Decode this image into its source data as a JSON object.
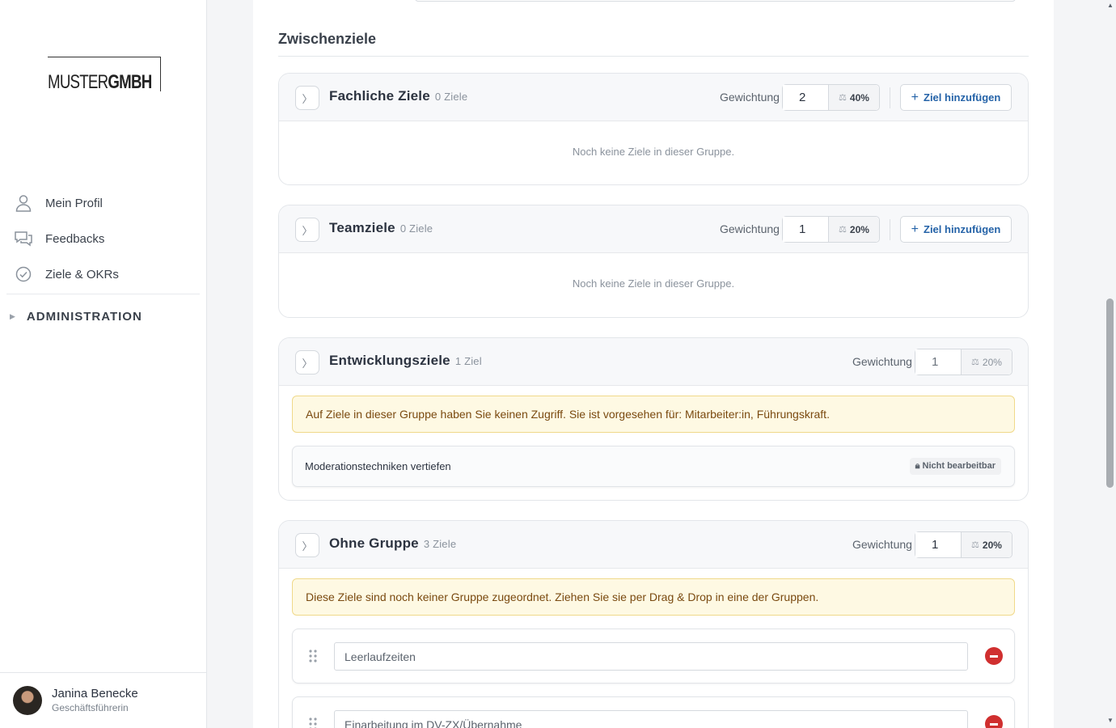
{
  "sidebar": {
    "logo": {
      "part1": "MUSTER",
      "part2": "GMBH"
    },
    "nav": [
      {
        "label": "Mein Profil",
        "icon": "user-icon"
      },
      {
        "label": "Feedbacks",
        "icon": "chat-bubbles-icon"
      },
      {
        "label": "Ziele & OKRs",
        "icon": "check-circle-icon"
      }
    ],
    "admin_label": "ADMINISTRATION",
    "user": {
      "name": "Janina Benecke",
      "role": "Geschäftsführerin"
    }
  },
  "section": {
    "title": "Zwischenziele"
  },
  "common": {
    "weight_label": "Gewichtung",
    "add_label": "Ziel hinzufügen",
    "empty_text": "Noch keine Ziele in dieser Gruppe.",
    "scale_icon": "scale-icon"
  },
  "groups": [
    {
      "name": "Fachliche Ziele",
      "count": "0 Ziele",
      "weight": "2",
      "percent": "40%"
    },
    {
      "name": "Teamziele",
      "count": "0 Ziele",
      "weight": "1",
      "percent": "20%"
    },
    {
      "name": "Entwicklungsziele",
      "count": "1 Ziel",
      "weight": "1",
      "percent": "20%",
      "warning": "Auf Ziele in dieser Gruppe haben Sie keinen Zugriff. Sie ist vorgesehen für: Mitarbeiter:in, Führungskraft.",
      "items": [
        {
          "title": "Moderationstechniken vertiefen",
          "badge": "Nicht bearbeitbar"
        }
      ]
    },
    {
      "name": "Ohne Gruppe",
      "count": "3 Ziele",
      "weight": "1",
      "percent": "20%",
      "warning": "Diese Ziele sind noch keiner Gruppe zugeordnet. Ziehen Sie sie per Drag & Drop in eine der Gruppen.",
      "goals": [
        "Leerlaufzeiten",
        "Einarbeitung im DV-ZX/Übernahme"
      ]
    }
  ],
  "colors": {
    "accent": "#2563a8",
    "danger": "#d02f2f",
    "warning_bg": "#fef9e3",
    "warning_text": "#7a4a10"
  }
}
